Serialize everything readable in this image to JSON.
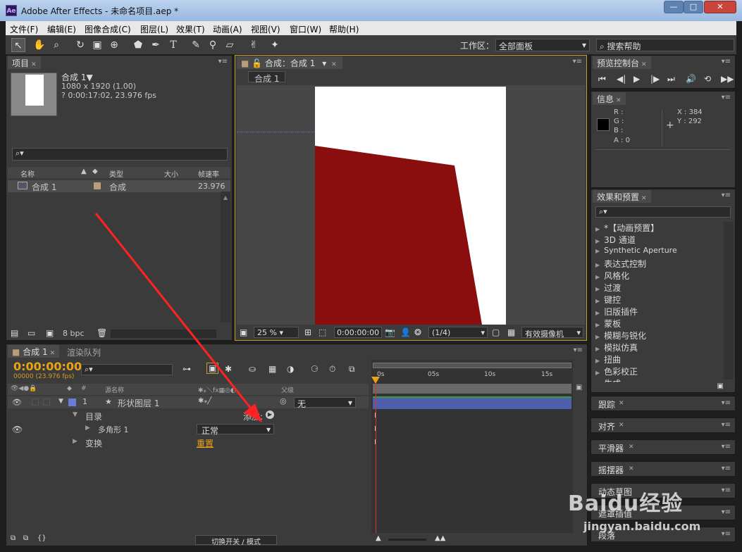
{
  "window": {
    "title": "Adobe After Effects - 未命名项目.aep *",
    "app_icon": "Ae",
    "min": "—",
    "max": "□",
    "close": "✕"
  },
  "menu": [
    "文件(F)",
    "编辑(E)",
    "图像合成(C)",
    "图层(L)",
    "效果(T)",
    "动画(A)",
    "视图(V)",
    "窗口(W)",
    "帮助(H)"
  ],
  "toolbar": {
    "workspace_label": "工作区：",
    "workspace_value": "全部面板",
    "search_help": "搜索帮助"
  },
  "project": {
    "tab": "项目",
    "comp_name": "合成 1▼",
    "comp_res": "1080 x 1920 (1.00)",
    "comp_dur": "? 0:00:17:02, 23.976 fps",
    "cols": [
      "名称",
      "类型",
      "大小",
      "帧速率"
    ],
    "items": [
      {
        "name": "合成 1",
        "type": "合成",
        "fps": "23.976"
      }
    ],
    "bpc": "8 bpc"
  },
  "viewer": {
    "tab": "合成：合成 1",
    "subtab": "合成 1",
    "zoom": "25 %",
    "timecode": "0:00:00:00",
    "res": "(1/4)",
    "camera": "有效摄像机"
  },
  "preview": {
    "tab": "预览控制台"
  },
  "info": {
    "tab": "信息",
    "r": "R :",
    "g": "G :",
    "b": "B :",
    "a": "A : 0",
    "x": "X : 384",
    "y": "Y : 292"
  },
  "effects": {
    "tab": "效果和预置",
    "items": [
      "*【动画预置】",
      "3D 通道",
      "Synthetic Aperture",
      "表达式控制",
      "风格化",
      "过渡",
      "键控",
      "旧版插件",
      "蒙板",
      "模糊与锐化",
      "模拟仿真",
      "扭曲",
      "色彩校正",
      "生成"
    ]
  },
  "side_panels": [
    "跟踪",
    "对齐",
    "平滑器",
    "摇摆器",
    "动态草图",
    "遮罩插值",
    "段落"
  ],
  "timeline": {
    "tab1": "合成 1",
    "tab2": "渲染队列",
    "timecode": "0:00:00:00",
    "fps": "00000 (23.976 fps)",
    "col_source": "源名称",
    "col_parent": "父级",
    "marks": [
      "0s",
      "05s",
      "10s",
      "15s"
    ],
    "layer_num": "1",
    "layer_name": "形状图层 1",
    "parent_val": "无",
    "contents": "目录",
    "add": "添加:",
    "polygon": "多角形 1",
    "blend": "正常",
    "transform": "变换",
    "reset": "重置",
    "switch_mode": "切换开关 / 模式"
  },
  "watermark": {
    "brand": "Baidu经验",
    "url": "jingyan.baidu.com"
  },
  "colors": {
    "shape": "#8a0e0e",
    "canvas": "#ffffff",
    "accent": "#e8a317",
    "layer_bar": "#4e5fae"
  }
}
